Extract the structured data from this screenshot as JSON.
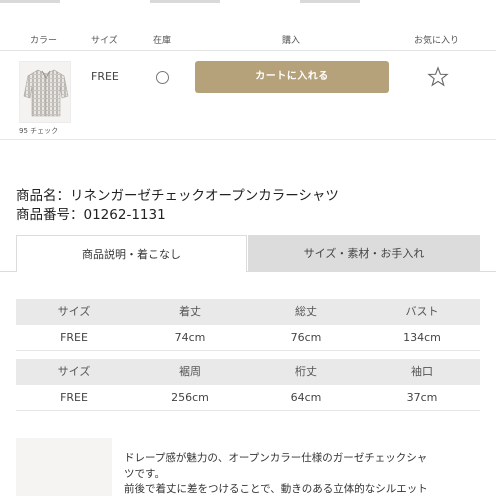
{
  "stock_table": {
    "columns": {
      "color": "カラー",
      "size": "サイズ",
      "stock": "在庫",
      "purchase": "購入",
      "favorite": "お気に入り"
    },
    "row": {
      "color_label": "95 チェック",
      "size": "FREE",
      "cart_button": "カートに入れる"
    }
  },
  "product": {
    "name": "商品名：リネンガーゼチェックオープンカラーシャツ",
    "code": "商品番号：01262-1131"
  },
  "tabs": [
    {
      "label": "商品説明・着こなし",
      "active": true
    },
    {
      "label": "サイズ・素材・お手入れ",
      "active": false
    }
  ],
  "size_table_1": {
    "headers": [
      "サイズ",
      "着丈",
      "総丈",
      "バスト"
    ],
    "values": [
      "FREE",
      "74cm",
      "76cm",
      "134cm"
    ]
  },
  "size_table_2": {
    "headers": [
      "サイズ",
      "裾周",
      "桁丈",
      "袖口"
    ],
    "values": [
      "FREE",
      "256cm",
      "64cm",
      "37cm"
    ]
  },
  "description": {
    "lines": [
      "ドレープ感が魅力の、オープンカラー仕様のガーゼチェックシャ",
      "ツです。",
      "前後で着丈に差をつけることで、動きのある立体的なシルエット"
    ]
  },
  "colors": {
    "cart_button": "#b6a27a",
    "header_row": "#e9e9e9",
    "inactive_tab": "#dcdcdc"
  }
}
